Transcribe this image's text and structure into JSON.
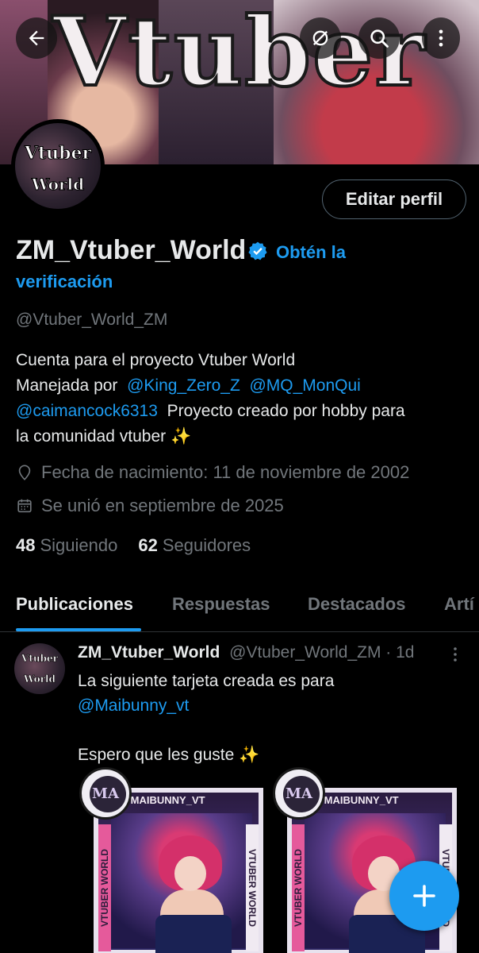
{
  "banner": {
    "title": "Vtuber"
  },
  "avatar": {
    "line1": "Vtuber",
    "line2": "World"
  },
  "actions": {
    "edit_profile": "Editar perfil"
  },
  "profile": {
    "display_name": "ZM_Vtuber_World",
    "verify_prompt_1": "Obtén la",
    "verify_prompt_2": "verificación",
    "handle": "@Vtuber_World_ZM",
    "bio": {
      "line1": "Cuenta para el proyecto Vtuber World",
      "line2_prefix": "Manejada por",
      "mention1": "@King_Zero_Z",
      "mention2": "@MQ_MonQui",
      "mention3": "@caimancock6313",
      "line3_suffix": "Proyecto creado por hobby para",
      "line4": "la comunidad vtuber ✨"
    },
    "birthday": "Fecha de nacimiento: 11 de noviembre de 2002",
    "joined": "Se unió en septiembre de 2025",
    "following_count": "48",
    "following_label": "Siguiendo",
    "followers_count": "62",
    "followers_label": "Seguidores"
  },
  "tabs": [
    "Publicaciones",
    "Respuestas",
    "Destacados",
    "Artí"
  ],
  "post": {
    "avatar_line1": "Vtuber",
    "avatar_line2": "World",
    "author_name": "ZM_Vtuber_World",
    "author_handle": "@Vtuber_World_ZM · 1d",
    "text_line1": "La siguiente tarjeta creada es para",
    "mention": "@Maibunny_vt",
    "text_line3": "Espero que les guste ✨",
    "cards": [
      {
        "logo": "MA",
        "top_label": "@MAIBUNNY_VT",
        "side_left": "VTUBER WORLD",
        "side_right": "VTUBER WORLD"
      },
      {
        "logo": "MA",
        "top_label": "@MAIBUNNY_VT",
        "side_left": "VTUBER WORLD",
        "side_right": "VTUBER WORLD"
      }
    ]
  },
  "icons": {
    "back": "arrow-left-icon",
    "grok": "grok-icon",
    "search": "search-icon",
    "more": "more-vertical-icon",
    "verified": "verified-badge-icon",
    "location": "location-pin-icon",
    "calendar": "calendar-icon",
    "compose": "plus-icon"
  },
  "colors": {
    "accent": "#1d9bf0",
    "muted": "#71767b",
    "text": "#e7e9ea",
    "background": "#000000"
  }
}
